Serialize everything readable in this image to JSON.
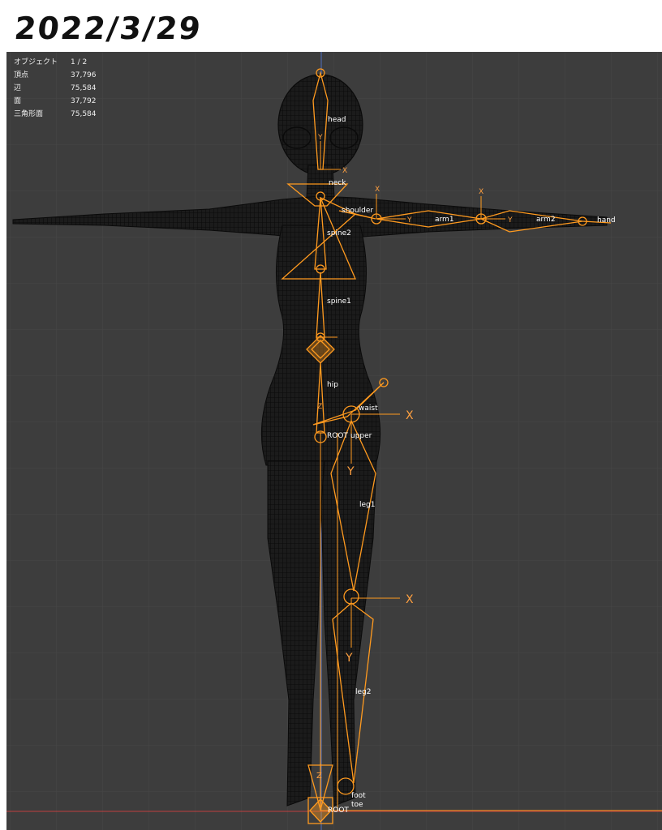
{
  "header": {
    "date": "2022/3/29"
  },
  "stats": {
    "rows": [
      {
        "label": "オブジェクト",
        "value": "1 / 2"
      },
      {
        "label": "頂点",
        "value": "37,796"
      },
      {
        "label": "辺",
        "value": "75,584"
      },
      {
        "label": "面",
        "value": "37,792"
      },
      {
        "label": "三角形面",
        "value": "75,584"
      }
    ]
  },
  "bones": {
    "head": "head",
    "neck": "neck",
    "shoulder": "shoulder",
    "arm1": "arm1",
    "arm2": "arm2",
    "hand": "hand",
    "spine2": "spine2",
    "spine1": "spine1",
    "hip": "hip",
    "waist": "waist",
    "root": "ROOT",
    "upper": "upper",
    "leg1": "leg1",
    "leg2": "leg2",
    "foot": "foot",
    "toe": "toe",
    "root_floor": "ROOT"
  },
  "axes": {
    "x": "X",
    "y": "Y",
    "z": "Z"
  },
  "colors": {
    "viewport_bg": "#3d3d3d",
    "grid": "#4a4a4a",
    "armature": "#ff9a1f",
    "mesh": "#0d0d0d",
    "x_axis": "#c04040",
    "y_axis": "#4060c0"
  }
}
